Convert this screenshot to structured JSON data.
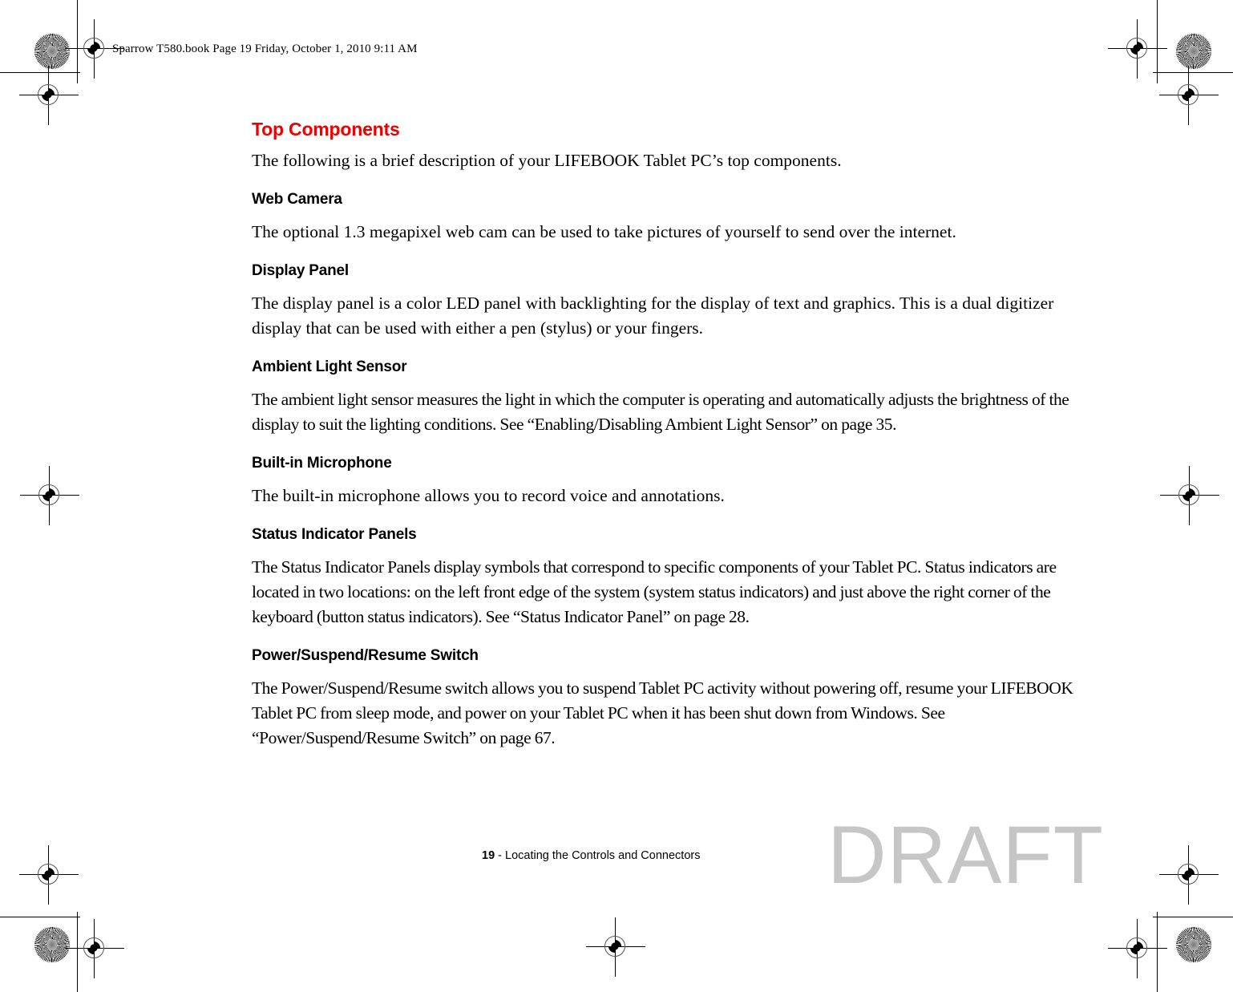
{
  "document": {
    "header_line": "Sparrow T580.book  Page 19  Friday, October 1, 2010  9:11 AM",
    "watermark": "DRAFT",
    "footer": {
      "page_number": "19",
      "separator": " - ",
      "chapter": "Locating the Controls and Connectors"
    },
    "accent_color": "#ee0000",
    "watermark_color": "#c6c6c6"
  },
  "section": {
    "title": "Top Components",
    "intro": "The following is a brief description of your LIFEBOOK Tablet PC’s top components.",
    "subsections": [
      {
        "heading": "Web Camera",
        "body": "The optional 1.3 megapixel web cam can be used to take pictures of yourself to send over the internet."
      },
      {
        "heading": "Display Panel",
        "body": "The display panel is a color LED panel with backlighting for the display of text and graphics. This is a dual digitizer display that can be used with either a pen (stylus) or your fingers."
      },
      {
        "heading": "Ambient Light Sensor",
        "body": "The ambient light sensor measures the light in which the computer is operating and automatically adjusts the brightness of the display to suit the lighting conditions. See “Enabling/Disabling Ambient Light Sensor” on page 35."
      },
      {
        "heading": "Built-in Microphone",
        "body": "The built-in microphone allows you to record voice and annotations."
      },
      {
        "heading": "Status Indicator Panels",
        "body": "The Status Indicator Panels display symbols that correspond to specific components of your Tablet PC. Status indicators are located in two locations: on the left front edge of the system (system status indicators) and just above the right corner of the keyboard (button status indicators). See “Status Indicator Panel” on page 28."
      },
      {
        "heading": "Power/Suspend/Resume Switch",
        "body": "The Power/Suspend/Resume switch allows you to suspend Tablet PC activity without powering off, resume your LIFEBOOK Tablet PC from sleep mode, and power on your Tablet PC when it has been shut down from Windows. See “Power/Suspend/Resume Switch” on page 67."
      }
    ]
  }
}
